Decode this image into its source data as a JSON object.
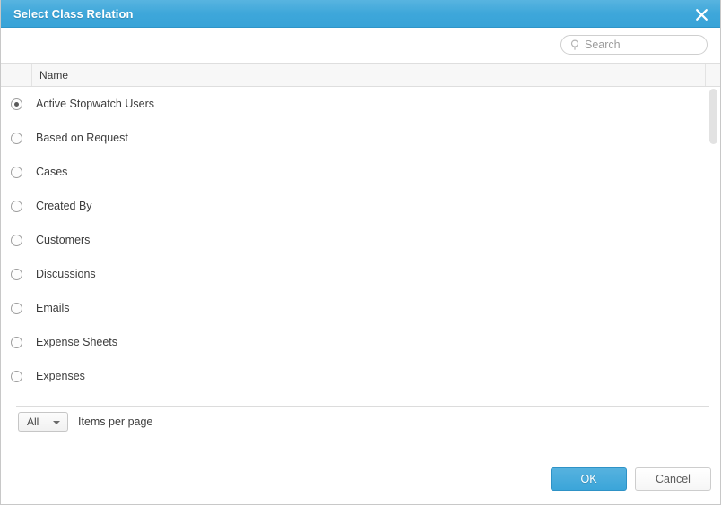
{
  "dialog": {
    "title": "Select Class Relation",
    "close_icon": "close-icon"
  },
  "search": {
    "placeholder": "Search",
    "value": "",
    "icon": "search-icon"
  },
  "grid": {
    "columns": [
      "Name"
    ],
    "rows": [
      {
        "label": "Active Stopwatch Users",
        "selected": true
      },
      {
        "label": "Based on Request",
        "selected": false
      },
      {
        "label": "Cases",
        "selected": false
      },
      {
        "label": "Created By",
        "selected": false
      },
      {
        "label": "Customers",
        "selected": false
      },
      {
        "label": "Discussions",
        "selected": false
      },
      {
        "label": "Emails",
        "selected": false
      },
      {
        "label": "Expense Sheets",
        "selected": false
      },
      {
        "label": "Expenses",
        "selected": false
      }
    ]
  },
  "pager": {
    "items_per_page_value": "All",
    "items_per_page_label": "Items per page",
    "options": [
      "All"
    ]
  },
  "footer": {
    "ok_label": "OK",
    "cancel_label": "Cancel"
  },
  "colors": {
    "accent": "#3ba5d9",
    "title_bar": "#43a9db",
    "text": "#3c3c3c",
    "border": "#dedede"
  }
}
